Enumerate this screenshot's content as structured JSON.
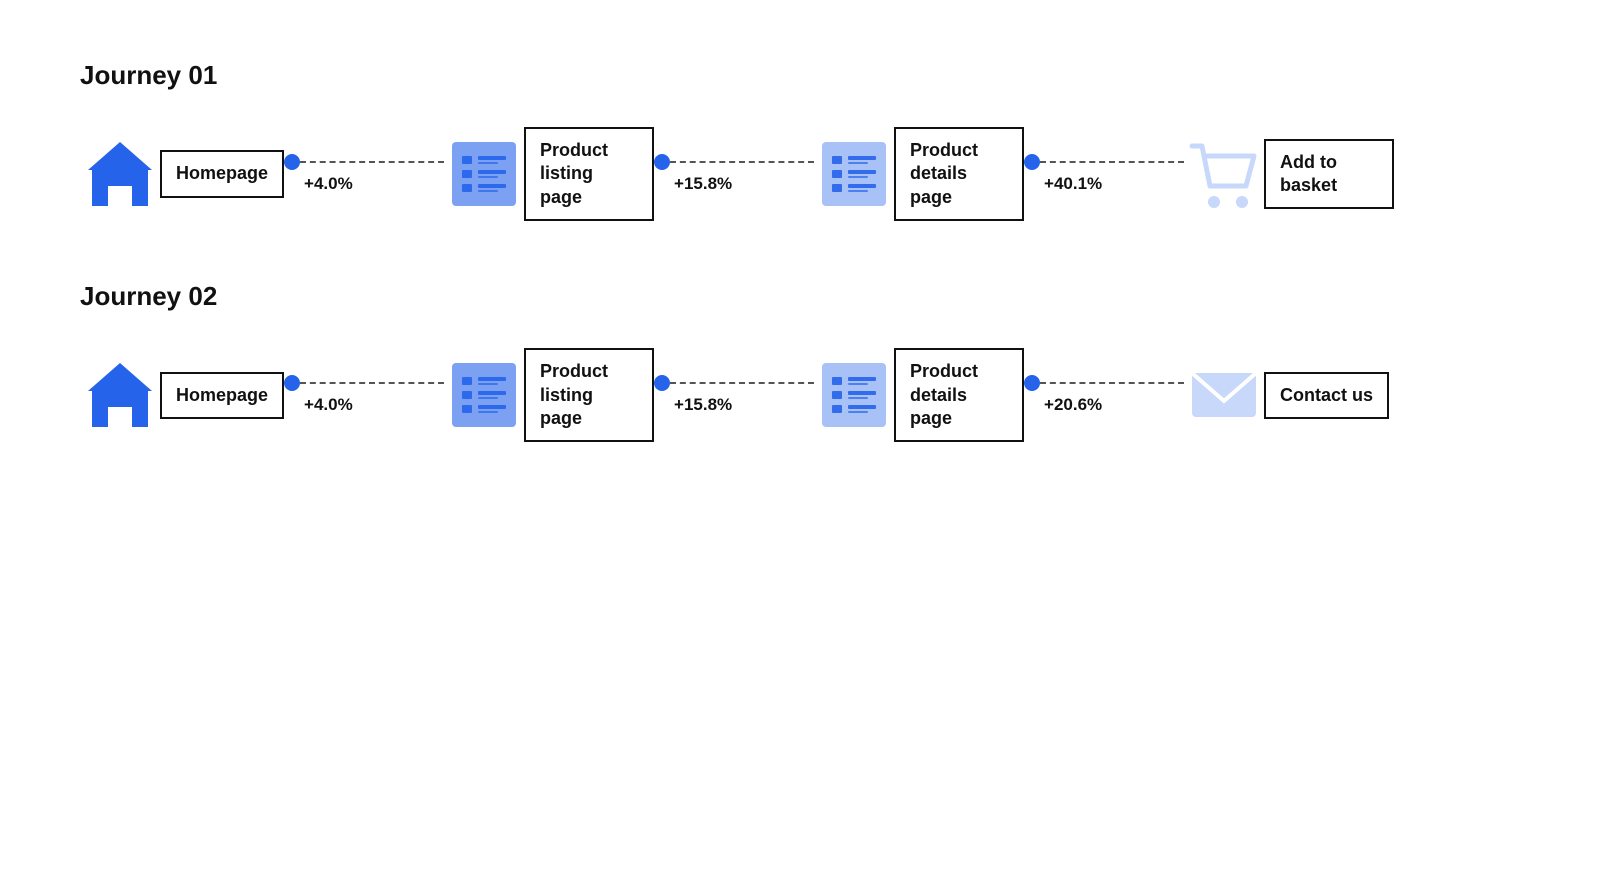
{
  "journeys": [
    {
      "id": "journey-01",
      "title": "Journey 01",
      "nodes": [
        {
          "id": "home1",
          "type": "home",
          "label": "Homepage"
        },
        {
          "id": "list1",
          "type": "list",
          "label": "Product listing page"
        },
        {
          "id": "detail1",
          "type": "list",
          "label": "Product details page"
        },
        {
          "id": "basket1",
          "type": "cart",
          "label": "Add to basket"
        }
      ],
      "connectors": [
        {
          "pct": "+4.0%"
        },
        {
          "pct": "+15.8%"
        },
        {
          "pct": "+40.1%"
        }
      ]
    },
    {
      "id": "journey-02",
      "title": "Journey 02",
      "nodes": [
        {
          "id": "home2",
          "type": "home",
          "label": "Homepage"
        },
        {
          "id": "list2",
          "type": "list",
          "label": "Product listing page"
        },
        {
          "id": "detail2",
          "type": "list",
          "label": "Product details page"
        },
        {
          "id": "contact2",
          "type": "email",
          "label": "Contact us"
        }
      ],
      "connectors": [
        {
          "pct": "+4.0%"
        },
        {
          "pct": "+15.8%"
        },
        {
          "pct": "+20.6%"
        }
      ]
    }
  ]
}
